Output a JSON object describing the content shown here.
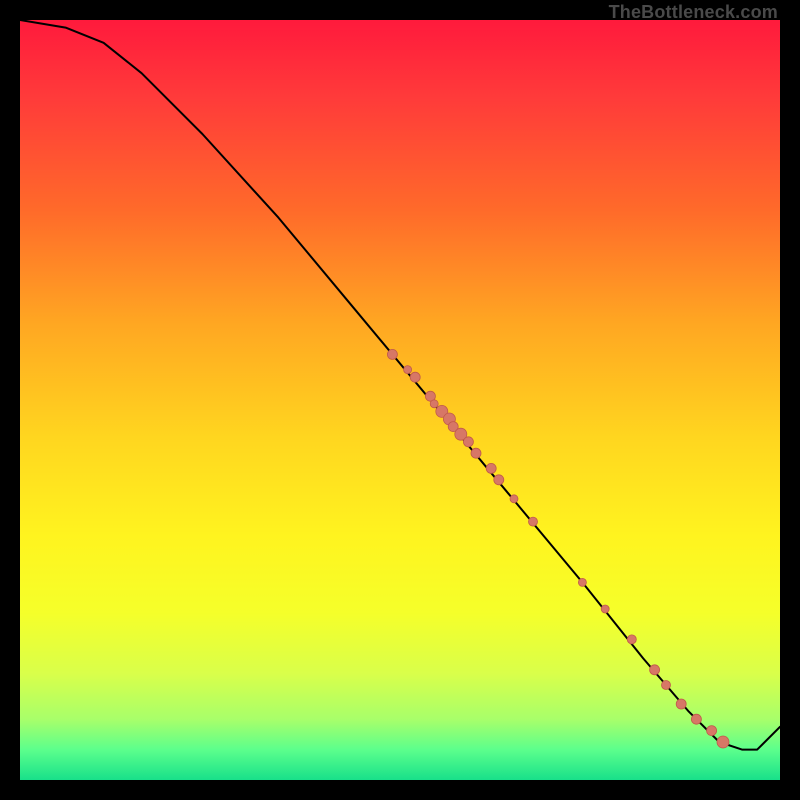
{
  "watermark": "TheBottleneck.com",
  "colors": {
    "frame": "#000000",
    "line": "#000000",
    "dot_fill": "#d77766",
    "dot_stroke": "#c05a4a"
  },
  "chart_data": {
    "type": "line",
    "title": "",
    "xlabel": "",
    "ylabel": "",
    "xlim": [
      0,
      100
    ],
    "ylim": [
      0,
      100
    ],
    "grid": false,
    "legend": false,
    "annotations": [
      "TheBottleneck.com"
    ],
    "series": [
      {
        "name": "bottleneck-curve",
        "x": [
          0,
          6,
          11,
          16,
          24,
          34,
          44,
          54,
          64,
          74,
          82,
          88,
          92,
          95,
          97,
          100
        ],
        "y": [
          100,
          99,
          97,
          93,
          85,
          74,
          62,
          50,
          38,
          26,
          16,
          9,
          5,
          4,
          4,
          7
        ]
      }
    ],
    "scatter_points": {
      "name": "highlighted-points",
      "x": [
        49,
        51,
        52,
        54,
        54.5,
        55.5,
        56.5,
        57,
        58,
        59,
        60,
        62,
        63,
        65,
        67.5,
        74,
        77,
        80.5,
        83.5,
        85,
        87,
        89,
        91,
        92.5
      ],
      "y": [
        56,
        54,
        53,
        50.5,
        49.5,
        48.5,
        47.5,
        46.5,
        45.5,
        44.5,
        43,
        41,
        39.5,
        37,
        34,
        26,
        22.5,
        18.5,
        14.5,
        12.5,
        10,
        8,
        6.5,
        5
      ],
      "size": [
        10,
        8,
        10,
        10,
        8,
        12,
        12,
        10,
        12,
        10,
        10,
        10,
        10,
        8,
        9,
        8,
        8,
        9,
        10,
        9,
        10,
        10,
        10,
        12
      ]
    }
  }
}
